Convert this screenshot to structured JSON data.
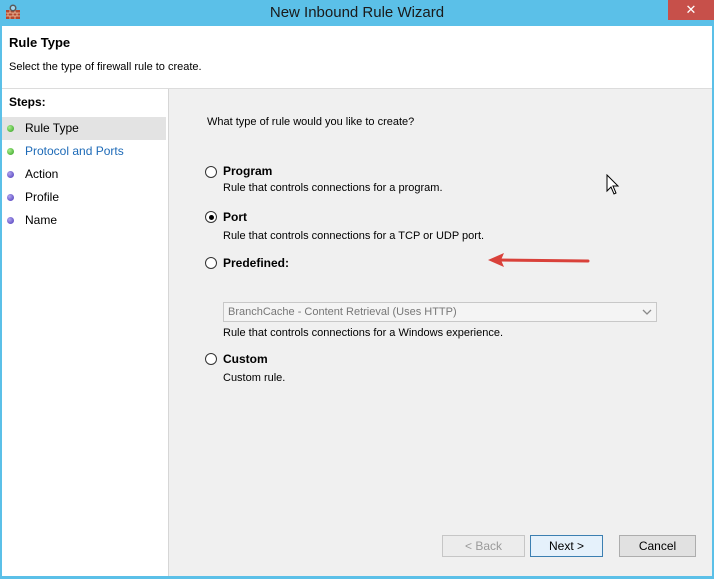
{
  "window": {
    "title": "New Inbound Rule Wizard",
    "close_glyph": "✕"
  },
  "header": {
    "title": "Rule Type",
    "subtitle": "Select the type of firewall rule to create."
  },
  "steps": {
    "title": "Steps:",
    "items": [
      {
        "label": "Rule Type",
        "state": "active",
        "dot": "green"
      },
      {
        "label": "Protocol and Ports",
        "state": "link",
        "dot": "green"
      },
      {
        "label": "Action",
        "state": "normal",
        "dot": "blue"
      },
      {
        "label": "Profile",
        "state": "normal",
        "dot": "blue"
      },
      {
        "label": "Name",
        "state": "normal",
        "dot": "blue"
      }
    ]
  },
  "content": {
    "question": "What type of rule would you like to create?",
    "options": [
      {
        "title": "Program",
        "description": "Rule that controls connections for a program.",
        "checked": false
      },
      {
        "title": "Port",
        "description": "Rule that controls connections for a TCP or UDP port.",
        "checked": true
      },
      {
        "title": "Predefined:",
        "description": "Rule that controls connections for a Windows experience.",
        "checked": false
      },
      {
        "title": "Custom",
        "description": "Custom rule.",
        "checked": false
      }
    ],
    "predefined_select": {
      "value": "BranchCache - Content Retrieval (Uses HTTP)",
      "disabled": true
    }
  },
  "buttons": {
    "back": "< Back",
    "next": "Next >",
    "cancel": "Cancel"
  },
  "colors": {
    "titlebar": "#5bc0e8",
    "close_button": "#c7504a",
    "annotation_arrow": "#d9413a",
    "link": "#1d6ab7"
  }
}
